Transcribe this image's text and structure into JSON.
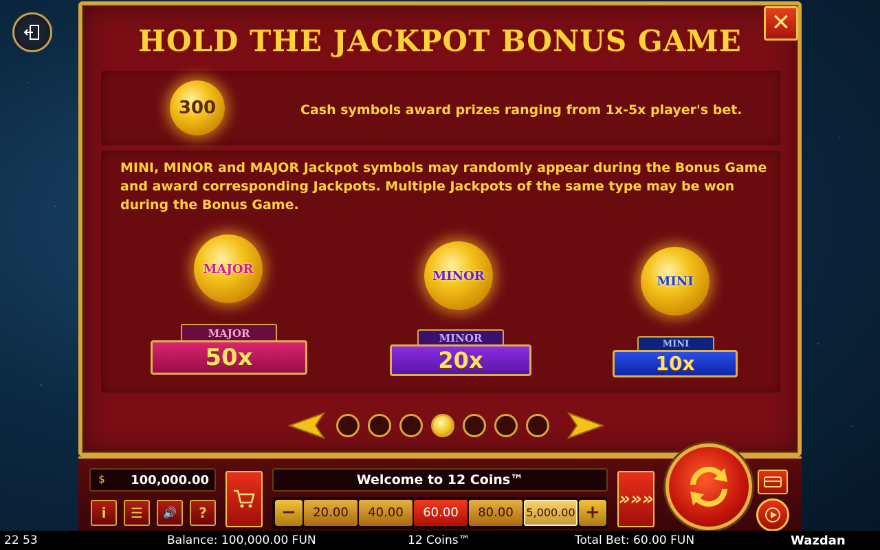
{
  "title": "HOLD THE JACKPOT BONUS GAME",
  "close_label": "✕",
  "cash_section": {
    "coin_value": "300",
    "description": "Cash symbols award prizes ranging from 1x-5x player's bet."
  },
  "jackpot_section": {
    "description": "MINI, MINOR and MAJOR Jackpot symbols may randomly appear during the Bonus Game and award corresponding Jackpots. Multiple Jackpots of the same type may be won during the Bonus Game.",
    "jackpots": [
      {
        "coin_label": "MAJOR",
        "tab_label": "MAJOR",
        "multiplier": "50x",
        "color": "#d8266f"
      },
      {
        "coin_label": "MINOR",
        "tab_label": "MINOR",
        "multiplier": "20x",
        "color": "#8a2ee0"
      },
      {
        "coin_label": "MINI",
        "tab_label": "MINI",
        "multiplier": "10x",
        "color": "#2a4ee8"
      }
    ]
  },
  "pager": {
    "total_pages": 7,
    "active_page": 4
  },
  "controls": {
    "balance": "100,000.00",
    "info_label": "i",
    "menu_label": "☰",
    "sound_label": "🔊",
    "help_label": "?",
    "welcome": "Welcome to 12 Coins™",
    "minus_label": "−",
    "plus_label": "+",
    "bet_options": [
      "20.00",
      "40.00",
      "60.00",
      "80.00",
      "5,000.00"
    ],
    "selected_bet": "60.00",
    "turbo_label": "»»»"
  },
  "status_bar": {
    "time": "22 53",
    "balance": "Balance: 100,000.00 FUN",
    "game": "12 Coins™",
    "total_bet": "Total Bet: 60.00 FUN",
    "brand": "Wazdan"
  },
  "colors": {
    "gold": "#ffd23a",
    "panel": "#7a0e14",
    "accent_red": "#e8301a"
  }
}
